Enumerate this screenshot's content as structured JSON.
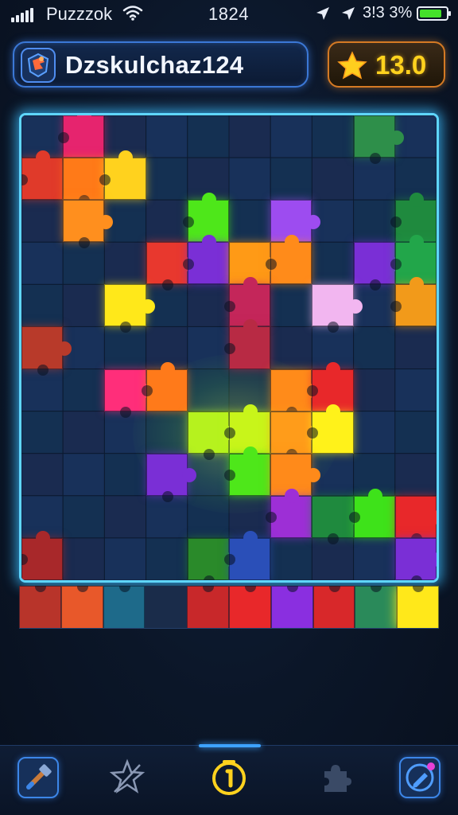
{
  "status_bar": {
    "carrier": "Puzzzok",
    "time": "1824",
    "right_text": "3!3 3%",
    "battery_level": 0.85,
    "battery_color": "#44e02a"
  },
  "header": {
    "title": "Dzskulchaz124",
    "title_icon": "puzzle-shield-icon",
    "score": "13.0",
    "score_icon": "star-icon"
  },
  "board": {
    "border_color": "#5fd6ff",
    "pieces": [
      {
        "row": 0,
        "col": 1,
        "color": "#e6246e"
      },
      {
        "row": 0,
        "col": 8,
        "color": "#2e8f4a"
      },
      {
        "row": 1,
        "col": 0,
        "color": "#e03a2a"
      },
      {
        "row": 1,
        "col": 1,
        "color": "#ff7a18"
      },
      {
        "row": 1,
        "col": 2,
        "color": "#ffd21e"
      },
      {
        "row": 2,
        "col": 1,
        "color": "#ff8f1e"
      },
      {
        "row": 2,
        "col": 4,
        "color": "#4ee71a"
      },
      {
        "row": 2,
        "col": 6,
        "color": "#9d4cf0"
      },
      {
        "row": 2,
        "col": 9,
        "color": "#1f8a3e"
      },
      {
        "row": 3,
        "col": 3,
        "color": "#e8382e"
      },
      {
        "row": 3,
        "col": 4,
        "color": "#7a2fd6"
      },
      {
        "row": 3,
        "col": 5,
        "color": "#ff9a16"
      },
      {
        "row": 3,
        "col": 6,
        "color": "#ff8b1a"
      },
      {
        "row": 3,
        "col": 8,
        "color": "#7a2fd6"
      },
      {
        "row": 3,
        "col": 9,
        "color": "#22a64a"
      },
      {
        "row": 4,
        "col": 2,
        "color": "#ffe81a"
      },
      {
        "row": 4,
        "col": 5,
        "color": "#c4265a"
      },
      {
        "row": 4,
        "col": 7,
        "color": "#f2b6f0"
      },
      {
        "row": 4,
        "col": 9,
        "color": "#f29a1a"
      },
      {
        "row": 5,
        "col": 0,
        "color": "#b83a2a"
      },
      {
        "row": 5,
        "col": 5,
        "color": "#b82a44"
      },
      {
        "row": 6,
        "col": 2,
        "color": "#ff2e7a"
      },
      {
        "row": 6,
        "col": 3,
        "color": "#ff7a1a"
      },
      {
        "row": 6,
        "col": 6,
        "color": "#ff8b1a"
      },
      {
        "row": 6,
        "col": 7,
        "color": "#e8282a"
      },
      {
        "row": 7,
        "col": 4,
        "color": "#b6f21e"
      },
      {
        "row": 7,
        "col": 5,
        "color": "#c8f51a"
      },
      {
        "row": 7,
        "col": 6,
        "color": "#ff9c1a"
      },
      {
        "row": 7,
        "col": 7,
        "color": "#fff21a"
      },
      {
        "row": 8,
        "col": 3,
        "color": "#7a2fd6"
      },
      {
        "row": 8,
        "col": 5,
        "color": "#4ee71a"
      },
      {
        "row": 8,
        "col": 6,
        "color": "#ff8a1a"
      },
      {
        "row": 9,
        "col": 6,
        "color": "#9d2fd6"
      },
      {
        "row": 9,
        "col": 7,
        "color": "#1f8a3e"
      },
      {
        "row": 9,
        "col": 8,
        "color": "#3ee21a"
      },
      {
        "row": 9,
        "col": 9,
        "color": "#e8282a"
      },
      {
        "row": 10,
        "col": 0,
        "color": "#a8282a"
      },
      {
        "row": 10,
        "col": 4,
        "color": "#2a8a2a"
      },
      {
        "row": 10,
        "col": 5,
        "color": "#2a4fb8"
      },
      {
        "row": 10,
        "col": 9,
        "color": "#7a2fd6"
      }
    ],
    "tray_pieces": [
      {
        "col": 0,
        "color": "#b8342a"
      },
      {
        "col": 1,
        "color": "#e8582a"
      },
      {
        "col": 2,
        "color": "#1e6a8a"
      },
      {
        "col": 4,
        "color": "#c8282a"
      },
      {
        "col": 5,
        "color": "#e8282a"
      },
      {
        "col": 6,
        "color": "#8a2fe0"
      },
      {
        "col": 7,
        "color": "#d8282a"
      },
      {
        "col": 8,
        "color": "#2a8a5a"
      },
      {
        "col": 9,
        "color": "#ffe81a"
      }
    ]
  },
  "nav": {
    "items": [
      {
        "icon": "hammer-icon",
        "label": "Tools"
      },
      {
        "icon": "star-outline-icon",
        "label": "Favorites"
      },
      {
        "icon": "timer-icon",
        "label": "Timer"
      },
      {
        "icon": "puzzle-piece-icon",
        "label": "Pieces"
      },
      {
        "icon": "edit-icon",
        "label": "Edit"
      }
    ],
    "active_index": 2,
    "accent_color": "#3da2ff"
  }
}
